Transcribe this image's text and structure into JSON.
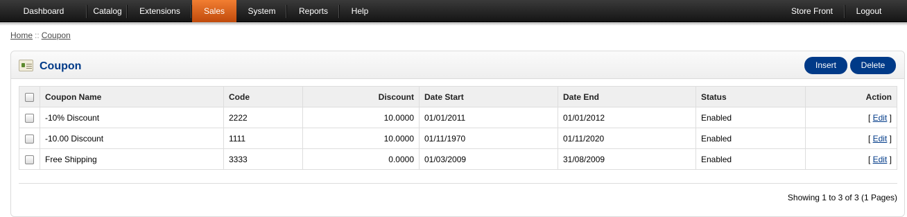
{
  "menu": {
    "left": [
      {
        "label": "Dashboard"
      },
      {
        "label": "Catalog"
      },
      {
        "label": "Extensions"
      },
      {
        "label": "Sales"
      },
      {
        "label": "System"
      },
      {
        "label": "Reports"
      },
      {
        "label": "Help"
      }
    ],
    "right": [
      {
        "label": "Store Front"
      },
      {
        "label": "Logout"
      }
    ],
    "active": "Sales"
  },
  "breadcrumb": {
    "home": "Home",
    "separator": "::",
    "current": "Coupon"
  },
  "page": {
    "title": "Coupon",
    "insert_label": "Insert",
    "delete_label": "Delete"
  },
  "table": {
    "headers": {
      "name": "Coupon Name",
      "code": "Code",
      "discount": "Discount",
      "date_start": "Date Start",
      "date_end": "Date End",
      "status": "Status",
      "action": "Action"
    },
    "rows": [
      {
        "name": "-10% Discount",
        "code": "2222",
        "discount": "10.0000",
        "date_start": "01/01/2011",
        "date_end": "01/01/2012",
        "status": "Enabled",
        "action_open": "[",
        "action_label": "Edit",
        "action_close": "]"
      },
      {
        "name": "-10.00 Discount",
        "code": "1111",
        "discount": "10.0000",
        "date_start": "01/11/1970",
        "date_end": "01/11/2020",
        "status": "Enabled",
        "action_open": "[",
        "action_label": "Edit",
        "action_close": "]"
      },
      {
        "name": "Free Shipping",
        "code": "3333",
        "discount": "0.0000",
        "date_start": "01/03/2009",
        "date_end": "31/08/2009",
        "status": "Enabled",
        "action_open": "[",
        "action_label": "Edit",
        "action_close": "]"
      }
    ]
  },
  "pagination": {
    "results": "Showing 1 to 3 of 3 (1 Pages)"
  },
  "colors": {
    "accent": "#003a88",
    "active_menu": "#e0621a"
  }
}
